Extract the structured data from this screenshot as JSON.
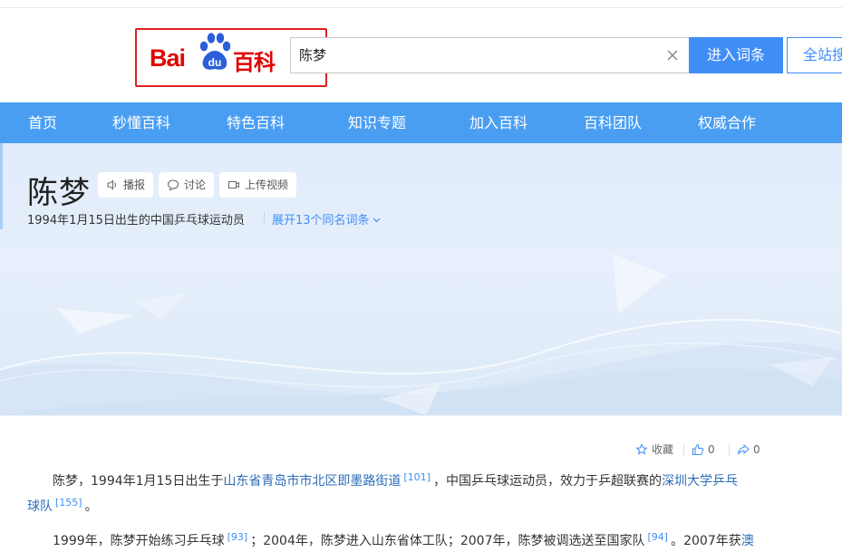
{
  "header": {
    "logo": {
      "bai": "Bai",
      "du": "du",
      "baike": "百科"
    },
    "search_value": "陈梦",
    "enter_label": "进入词条",
    "site_label": "全站搜"
  },
  "nav": {
    "items": [
      {
        "label": "首页"
      },
      {
        "label": "秒懂百科"
      },
      {
        "label": "特色百科"
      },
      {
        "label": "知识专题"
      },
      {
        "label": "加入百科"
      },
      {
        "label": "百科团队"
      },
      {
        "label": "权威合作"
      }
    ]
  },
  "entry": {
    "title": "陈梦",
    "chips": {
      "broadcast": "播报",
      "discuss": "讨论",
      "upload_video": "上传视频"
    },
    "subtitle": "1994年1月15日出生的中国乒乓球运动员",
    "expand": "展开13个同名词条"
  },
  "actions": {
    "collect": "收藏",
    "likes": "0",
    "shares": "0"
  },
  "paragraphs": {
    "p1": {
      "t1": "陈梦，1994年1月15日出生于",
      "link1": "山东省青岛市市北区即墨路街道",
      "ref1": "[101]",
      "t2": "，中国乒乓球运动员，效力于乒超联赛的",
      "link2": "深圳大学乒乓球队",
      "ref2": "[155]",
      "t3": "。"
    },
    "p2": {
      "t1": "1999年，陈梦开始练习乒乓球",
      "ref1": "[93]",
      "t2": "；2004年，陈梦进入山东省体工队；2007年，陈梦被调选送至国家队",
      "ref2": "[94]",
      "t3": "。2007年获",
      "link1": "澳"
    }
  },
  "colors": {
    "brand_red": "#e10601",
    "accent_blue": "#3f8ef7",
    "nav_blue": "#4a9ef2"
  }
}
